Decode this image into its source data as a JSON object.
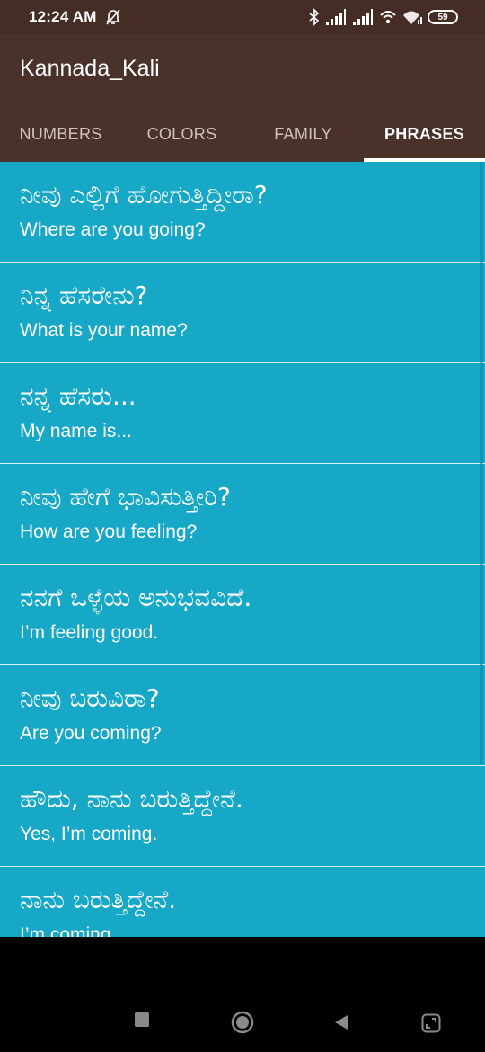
{
  "status_bar": {
    "time": "12:24 AM",
    "battery": "59"
  },
  "app": {
    "title": "Kannada_Kali"
  },
  "tabs": [
    {
      "label": "NUMBERS",
      "active": false
    },
    {
      "label": "COLORS",
      "active": false
    },
    {
      "label": "FAMILY",
      "active": false
    },
    {
      "label": "PHRASES",
      "active": true
    }
  ],
  "phrases": [
    {
      "kannada": "ನೀವು ಎಲ್ಲಿಗೆ ಹೋಗುತ್ತಿದ್ದೀರಾ?",
      "english": "Where are you going?"
    },
    {
      "kannada": "ನಿನ್ನ ಹೆಸರೇನು?",
      "english": "What is your name?"
    },
    {
      "kannada": "ನನ್ನ ಹೆಸರು...",
      "english": "My name is..."
    },
    {
      "kannada": "ನೀವು ಹೇಗೆ ಭಾವಿಸುತ್ತೀರಿ?",
      "english": "How are you feeling?"
    },
    {
      "kannada": "ನನಗೆ ಒಳ್ಳೆಯ ಅನುಭವವಿದೆ.",
      "english": "I’m feeling good."
    },
    {
      "kannada": "ನೀವು ಬರುವಿರಾ?",
      "english": "Are you coming?"
    },
    {
      "kannada": "ಹೌದು, ನಾನು ಬರುತ್ತಿದ್ದೇನೆ.",
      "english": "Yes, I’m coming."
    },
    {
      "kannada": "ನಾನು ಬರುತ್ತಿದ್ದೇನೆ.",
      "english": "I’m coming."
    }
  ],
  "colors": {
    "app_bar": "#4a3129",
    "list_background": "#17a7c7",
    "divider": "#d8f0f6"
  },
  "icons": [
    "alarm-off-icon",
    "bluetooth-icon",
    "signal-icon",
    "wifi-icon",
    "battery-icon",
    "recents-icon",
    "home-icon",
    "back-icon",
    "screenshot-icon"
  ]
}
